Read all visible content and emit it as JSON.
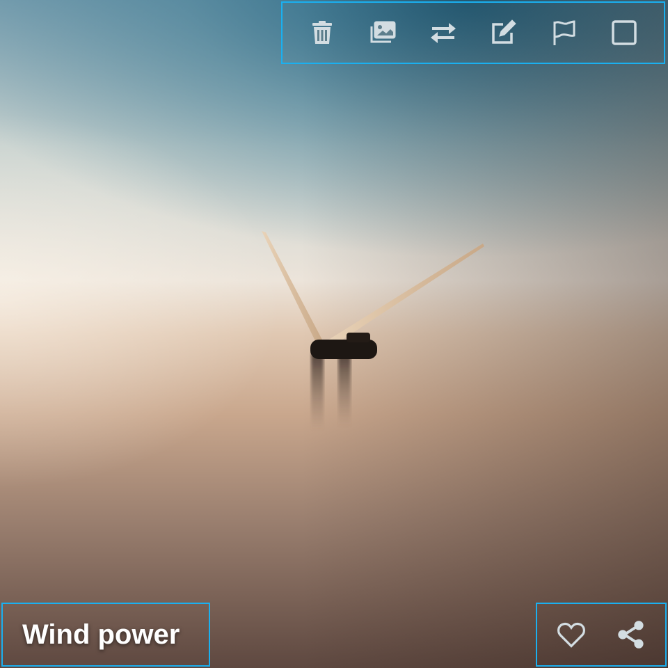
{
  "card": {
    "title": "Wind power"
  },
  "toolbar": {
    "items": [
      {
        "icon": "trash-icon"
      },
      {
        "icon": "images-icon"
      },
      {
        "icon": "swap-arrows-icon"
      },
      {
        "icon": "edit-icon"
      },
      {
        "icon": "flag-icon"
      },
      {
        "icon": "checkbox-icon"
      }
    ]
  },
  "actions": {
    "items": [
      {
        "icon": "heart-icon"
      },
      {
        "icon": "share-icon"
      }
    ]
  },
  "colors": {
    "highlight_border": "#1ab0f0",
    "icon": "#d3dde2"
  }
}
